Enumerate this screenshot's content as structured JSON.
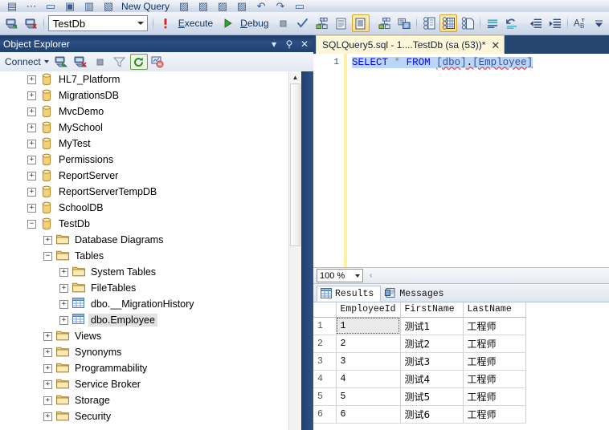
{
  "app": {
    "database_selector": {
      "value": "TestDb"
    },
    "accent_colors": {
      "title_bar": "#20406e",
      "tab_active": "#fdf6d8",
      "selection": "#bcd6f7",
      "toolbar_active": "#ffd983"
    }
  },
  "toolbar": {
    "row1": [
      {
        "name": "new-project-icon",
        "glyph": "▤"
      },
      {
        "name": "new-item-icon",
        "glyph": "⋯"
      },
      {
        "name": "open-file-icon",
        "glyph": "▭"
      },
      {
        "name": "save-icon",
        "glyph": "▣"
      },
      {
        "name": "save-all-icon",
        "glyph": "▥"
      },
      {
        "name": "new-query-icon",
        "glyph": "▧"
      },
      {
        "name": "new-query-label",
        "label": "New Query",
        "underline": "N"
      },
      {
        "name": "database-engine-query-icon",
        "glyph": "▨"
      },
      {
        "name": "analysis-services-mdx-query-icon",
        "glyph": "▨"
      },
      {
        "name": "analysis-services-dmx-query-icon",
        "glyph": "▨"
      },
      {
        "name": "analysis-services-xmla-query-icon",
        "glyph": "▨"
      },
      {
        "name": "undo-icon",
        "glyph": "↶"
      },
      {
        "name": "redo-icon",
        "glyph": "↷"
      },
      {
        "name": "more-tools-icon",
        "glyph": "▭"
      }
    ],
    "row2": {
      "connect_object_explorer_icon": "connect-object-explorer-icon",
      "disconnect_object_explorer_icon": "disconnect-object-explorer-icon",
      "database_label": "TestDb",
      "execute_label": "Execute",
      "execute_underline": "E",
      "debug_label": "Debug",
      "debug_underline": "D",
      "buttons": [
        {
          "name": "stop-button",
          "glyph": "■"
        },
        {
          "name": "parse-query-button",
          "glyph": "✓"
        },
        {
          "name": "display-estimated-execution-plan-button",
          "glyph": "▨"
        },
        {
          "name": "query-options-button",
          "glyph": "▤"
        },
        {
          "name": "include-actual-execution-plan-button",
          "glyph": "▤",
          "active": true
        },
        {
          "name": "include-client-statistics-button",
          "glyph": "▨"
        },
        {
          "name": "results-to-text-button",
          "glyph": "▥"
        },
        {
          "name": "results-to-grid-button",
          "glyph": "▦",
          "active": false
        },
        {
          "name": "results-to-file-button",
          "glyph": "▧"
        },
        {
          "name": "results-to-grid-2-button",
          "glyph": "▦",
          "active": true
        },
        {
          "name": "comment-lines-button",
          "glyph": "≡"
        },
        {
          "name": "uncomment-lines-button",
          "glyph": "↶"
        },
        {
          "name": "decrease-indent-button",
          "glyph": "⇤"
        },
        {
          "name": "increase-indent-button",
          "glyph": "⇥"
        },
        {
          "name": "font-size-button",
          "glyph": "A"
        },
        {
          "name": "toolbar-overflow-button",
          "glyph": "⌵"
        }
      ]
    }
  },
  "object_explorer": {
    "title": "Object Explorer",
    "window_buttons": [
      {
        "name": "window-dropdown-icon",
        "glyph": "▾"
      },
      {
        "name": "auto-hide-pin-icon",
        "glyph": "⚑"
      },
      {
        "name": "close-panel-icon",
        "glyph": "✕"
      }
    ],
    "toolbar": {
      "connect_label": "Connect",
      "buttons": [
        {
          "name": "connect-icon",
          "glyph": "▤"
        },
        {
          "name": "disconnect-icon",
          "glyph": "▤"
        },
        {
          "name": "stop-icon",
          "glyph": "■"
        },
        {
          "name": "filter-icon",
          "glyph": "∇"
        },
        {
          "name": "refresh-icon",
          "glyph": "↻"
        },
        {
          "name": "activity-monitor-icon",
          "glyph": "▥"
        }
      ]
    },
    "tree": [
      {
        "label": "HL7_Platform",
        "indent": 0,
        "state": "collapsed",
        "icon": "database-icon"
      },
      {
        "label": "MigrationsDB",
        "indent": 0,
        "state": "collapsed",
        "icon": "database-icon"
      },
      {
        "label": "MvcDemo",
        "indent": 0,
        "state": "collapsed",
        "icon": "database-icon"
      },
      {
        "label": "MySchool",
        "indent": 0,
        "state": "collapsed",
        "icon": "database-icon"
      },
      {
        "label": "MyTest",
        "indent": 0,
        "state": "collapsed",
        "icon": "database-icon"
      },
      {
        "label": "Permissions",
        "indent": 0,
        "state": "collapsed",
        "icon": "database-icon"
      },
      {
        "label": "ReportServer",
        "indent": 0,
        "state": "collapsed",
        "icon": "database-icon"
      },
      {
        "label": "ReportServerTempDB",
        "indent": 0,
        "state": "collapsed",
        "icon": "database-icon"
      },
      {
        "label": "SchoolDB",
        "indent": 0,
        "state": "collapsed",
        "icon": "database-icon"
      },
      {
        "label": "TestDb",
        "indent": 0,
        "state": "expanded",
        "icon": "database-icon"
      },
      {
        "label": "Database Diagrams",
        "indent": 1,
        "state": "collapsed",
        "icon": "folder-icon"
      },
      {
        "label": "Tables",
        "indent": 1,
        "state": "expanded",
        "icon": "folder-icon"
      },
      {
        "label": "System Tables",
        "indent": 2,
        "state": "collapsed",
        "icon": "folder-icon"
      },
      {
        "label": "FileTables",
        "indent": 2,
        "state": "collapsed",
        "icon": "folder-icon"
      },
      {
        "label": "dbo.__MigrationHistory",
        "indent": 2,
        "state": "collapsed",
        "icon": "table-icon"
      },
      {
        "label": "dbo.Employee",
        "indent": 2,
        "state": "collapsed",
        "icon": "table-icon",
        "selected": true
      },
      {
        "label": "Views",
        "indent": 1,
        "state": "collapsed",
        "icon": "folder-icon"
      },
      {
        "label": "Synonyms",
        "indent": 1,
        "state": "collapsed",
        "icon": "folder-icon"
      },
      {
        "label": "Programmability",
        "indent": 1,
        "state": "collapsed",
        "icon": "folder-icon"
      },
      {
        "label": "Service Broker",
        "indent": 1,
        "state": "collapsed",
        "icon": "folder-icon"
      },
      {
        "label": "Storage",
        "indent": 1,
        "state": "collapsed",
        "icon": "folder-icon"
      },
      {
        "label": "Security",
        "indent": 1,
        "state": "collapsed",
        "icon": "folder-icon"
      }
    ],
    "scrollbar": {
      "up_arrow": "▲"
    }
  },
  "editor": {
    "tab": {
      "title": "SQLQuery5.sql - 1....TestDb (sa (53))*",
      "close_glyph": "✕"
    },
    "line_numbers": [
      "1"
    ],
    "sql": {
      "full_text": "SELECT * FROM [dbo].[Employee]",
      "tokens": {
        "select": "SELECT",
        "star": "*",
        "from": "FROM",
        "schema": "[dbo]",
        "dot": ".",
        "table": "[Employee]"
      }
    },
    "zoom": {
      "value": "100 %"
    }
  },
  "results": {
    "tabs": [
      {
        "label": "Results",
        "icon": "grid-icon",
        "active": true
      },
      {
        "label": "Messages",
        "icon": "messages-icon",
        "active": false
      }
    ],
    "columns": [
      "EmployeeId",
      "FirstName",
      "LastName"
    ],
    "rows": [
      {
        "n": "1",
        "EmployeeId": "1",
        "FirstName": "测试1",
        "LastName": "工程师"
      },
      {
        "n": "2",
        "EmployeeId": "2",
        "FirstName": "测试2",
        "LastName": "工程师"
      },
      {
        "n": "3",
        "EmployeeId": "3",
        "FirstName": "测试3",
        "LastName": "工程师"
      },
      {
        "n": "4",
        "EmployeeId": "4",
        "FirstName": "测试4",
        "LastName": "工程师"
      },
      {
        "n": "5",
        "EmployeeId": "5",
        "FirstName": "测试5",
        "LastName": "工程师"
      },
      {
        "n": "6",
        "EmployeeId": "6",
        "FirstName": "测试6",
        "LastName": "工程师"
      }
    ],
    "focused_cell": {
      "row": 0,
      "column": "EmployeeId"
    }
  }
}
